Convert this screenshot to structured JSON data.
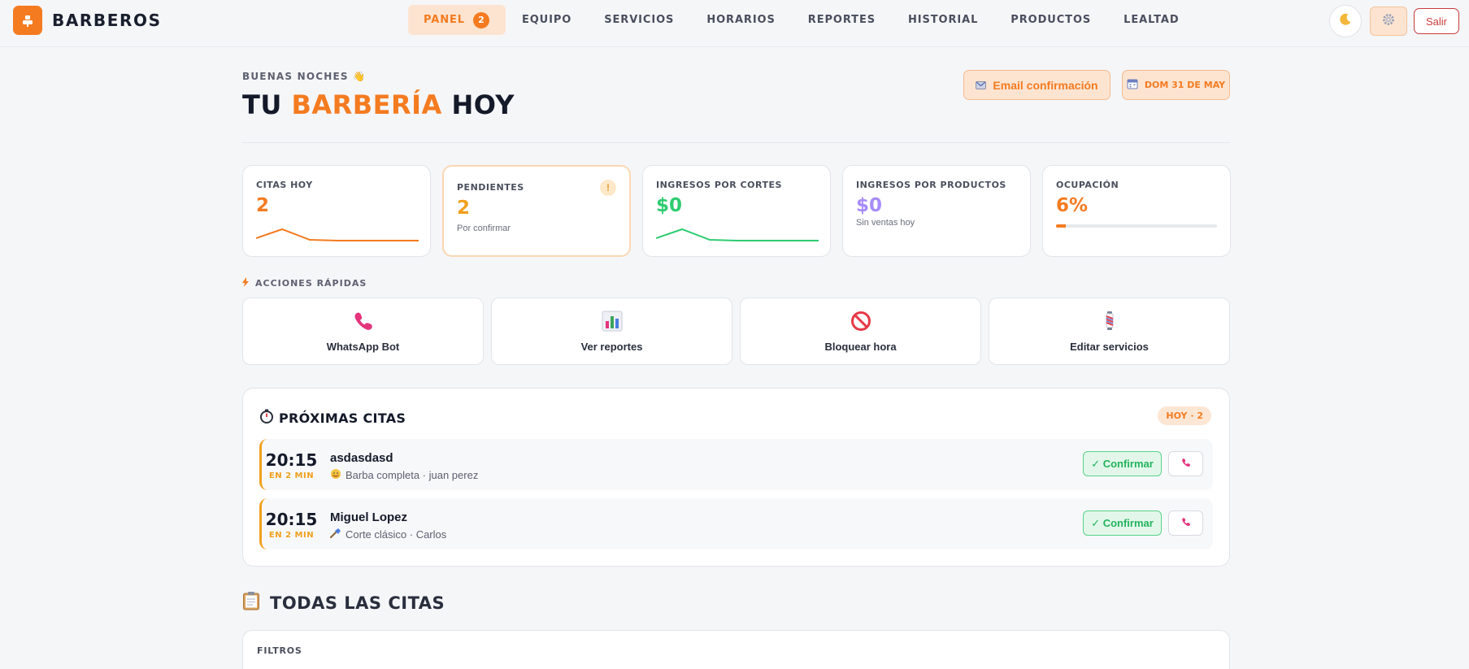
{
  "brand": {
    "name": "BARBEROS",
    "accent": "#f47b20"
  },
  "nav": {
    "items": [
      {
        "label": "PANEL",
        "badge": "2",
        "active": true
      },
      {
        "label": "EQUIPO"
      },
      {
        "label": "SERVICIOS"
      },
      {
        "label": "HORARIOS"
      },
      {
        "label": "REPORTES"
      },
      {
        "label": "HISTORIAL"
      },
      {
        "label": "PRODUCTOS"
      },
      {
        "label": "LEALTAD"
      }
    ],
    "theme_icon": "moon-icon",
    "settings_icon": "gear-icon",
    "logout_label": "Salir"
  },
  "header": {
    "greeting": "BUENAS NOCHES 👋",
    "title_pre": "TU ",
    "title_accent": "BARBERÍA",
    "title_post": " HOY",
    "email_button": "Email confirmación",
    "date_button": "DOM 31 DE MAY"
  },
  "stats": {
    "citas_hoy": {
      "label": "CITAS HOY",
      "value": "2",
      "color": "#f47b20"
    },
    "pendientes": {
      "label": "PENDIENTES",
      "value": "2",
      "sub": "Por confirmar",
      "alert": "!",
      "color": "#f0a01f"
    },
    "ingresos_cortes": {
      "label": "INGRESOS POR CORTES",
      "value": "$0",
      "color": "#2ecc71"
    },
    "ingresos_productos": {
      "label": "INGRESOS POR PRODUCTOS",
      "value": "$0",
      "sub": "Sin ventas hoy",
      "color": "#a78bfa"
    },
    "ocupacion": {
      "label": "OCUPACIÓN",
      "value": "6%",
      "percent": 6,
      "color": "#f47b20"
    }
  },
  "quick_actions": {
    "title": "ACCIONES RÁPIDAS",
    "items": [
      {
        "label": "WhatsApp Bot",
        "icon": "phone-icon"
      },
      {
        "label": "Ver reportes",
        "icon": "bar-chart-icon"
      },
      {
        "label": "Bloquear hora",
        "icon": "prohibited-icon"
      },
      {
        "label": "Editar servicios",
        "icon": "barber-pole-icon"
      }
    ]
  },
  "upcoming": {
    "title": "PRÓXIMAS CITAS",
    "badge": "HOY · 2",
    "items": [
      {
        "time": "20:15",
        "in": "EN 2 MIN",
        "name": "asdasdasd",
        "service": "Barba completa · juan perez",
        "service_icon": "beard-icon",
        "confirm": "✓ Confirmar"
      },
      {
        "time": "20:15",
        "in": "EN 2 MIN",
        "name": "Miguel Lopez",
        "service": "Corte clásico · Carlos",
        "service_icon": "razor-icon",
        "confirm": "✓ Confirmar"
      }
    ]
  },
  "all": {
    "title": "TODAS LAS CITAS",
    "filters_label": "FILTROS"
  }
}
